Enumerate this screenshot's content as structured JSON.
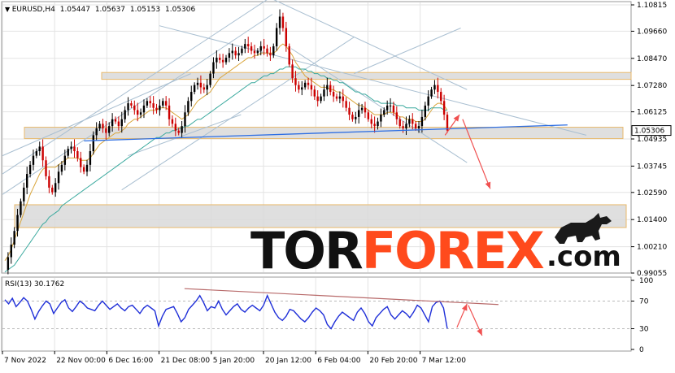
{
  "chart_data": [
    {
      "type": "candlestick",
      "symbol": "EURUSD",
      "timeframe": "H4",
      "ohlc": [
        "1.05447",
        "1.05637",
        "1.05153",
        "1.05306"
      ],
      "current_price": "1.05306",
      "y_tick_labels": [
        "1.10815",
        "1.09660",
        "1.08470",
        "1.07280",
        "1.06125",
        "1.04935",
        "1.03745",
        "1.02590",
        "1.01400",
        "1.00210",
        "0.99055"
      ],
      "y_ticks": [
        1.10815,
        1.0966,
        1.0847,
        1.0728,
        1.06125,
        1.04935,
        1.03745,
        1.0259,
        1.014,
        1.0021,
        0.99055
      ],
      "ylim": [
        0.99055,
        1.10815
      ],
      "x_tick_labels": [
        "7 Nov 2022",
        "22 Nov 00:00",
        "6 Dec 16:00",
        "21 Dec 08:00",
        "5 Jan 20:00",
        "20 Jan 12:00",
        "6 Feb 04:00",
        "20 Feb 20:00",
        "7 Mar 12:00"
      ],
      "grid": true,
      "close_series": [
        0.992,
        0.9975,
        1.003,
        1.009,
        1.016,
        1.022,
        1.028,
        1.034,
        1.038,
        1.042,
        1.044,
        1.046,
        1.04,
        1.033,
        1.028,
        1.026,
        1.03,
        1.035,
        1.038,
        1.042,
        1.045,
        1.046,
        1.044,
        1.041,
        1.037,
        1.035,
        1.038,
        1.044,
        1.051,
        1.054,
        1.056,
        1.054,
        1.052,
        1.055,
        1.058,
        1.057,
        1.055,
        1.058,
        1.062,
        1.065,
        1.064,
        1.062,
        1.06,
        1.061,
        1.064,
        1.066,
        1.065,
        1.063,
        1.062,
        1.064,
        1.066,
        1.064,
        1.058,
        1.056,
        1.053,
        1.052,
        1.055,
        1.061,
        1.066,
        1.07,
        1.073,
        1.074,
        1.072,
        1.071,
        1.073,
        1.078,
        1.083,
        1.085,
        1.084,
        1.083,
        1.085,
        1.087,
        1.088,
        1.086,
        1.087,
        1.089,
        1.091,
        1.09,
        1.088,
        1.087,
        1.088,
        1.09,
        1.089,
        1.087,
        1.086,
        1.09,
        1.098,
        1.103,
        1.098,
        1.09,
        1.082,
        1.076,
        1.073,
        1.071,
        1.072,
        1.074,
        1.073,
        1.071,
        1.068,
        1.066,
        1.068,
        1.071,
        1.073,
        1.07,
        1.068,
        1.067,
        1.068,
        1.066,
        1.063,
        1.06,
        1.058,
        1.059,
        1.062,
        1.063,
        1.061,
        1.058,
        1.056,
        1.055,
        1.057,
        1.06,
        1.062,
        1.064,
        1.064,
        1.061,
        1.058,
        1.055,
        1.054,
        1.056,
        1.058,
        1.056,
        1.054,
        1.055,
        1.059,
        1.064,
        1.068,
        1.071,
        1.073,
        1.07,
        1.066,
        1.06,
        1.05306
      ],
      "ma_series": [
        {
          "values": [
            0.996,
            0.998,
            1.001,
            1.005,
            1.009,
            1.013,
            1.017,
            1.021,
            1.025,
            1.028,
            1.031,
            1.034,
            1.036,
            1.037,
            1.037,
            1.037,
            1.037,
            1.038,
            1.039,
            1.04,
            1.041,
            1.041,
            1.041,
            1.041,
            1.04,
            1.04,
            1.04,
            1.041,
            1.043,
            1.045,
            1.047,
            1.048,
            1.049,
            1.05,
            1.051,
            1.052,
            1.052,
            1.053,
            1.054,
            1.056,
            1.057,
            1.058,
            1.058,
            1.059,
            1.06,
            1.061,
            1.062,
            1.062,
            1.062,
            1.063,
            1.063,
            1.063,
            1.062,
            1.061,
            1.06,
            1.059,
            1.058,
            1.059,
            1.06,
            1.062,
            1.064,
            1.066,
            1.067,
            1.068,
            1.069,
            1.07,
            1.072,
            1.074,
            1.076,
            1.077,
            1.078,
            1.079,
            1.08,
            1.081,
            1.082,
            1.083,
            1.084,
            1.085,
            1.085,
            1.086,
            1.086,
            1.087,
            1.087,
            1.087,
            1.087,
            1.087,
            1.088,
            1.09,
            1.091,
            1.09,
            1.088,
            1.086,
            1.083,
            1.081,
            1.079,
            1.077,
            1.076,
            1.075,
            1.074,
            1.073,
            1.072,
            1.072,
            1.072,
            1.071,
            1.071,
            1.07,
            1.07,
            1.069,
            1.068,
            1.067,
            1.066,
            1.065,
            1.064,
            1.064,
            1.063,
            1.062,
            1.061,
            1.06,
            1.06,
            1.06,
            1.06,
            1.061,
            1.061,
            1.061,
            1.06,
            1.059,
            1.059,
            1.058,
            1.058,
            1.058,
            1.057,
            1.057,
            1.057,
            1.058,
            1.06,
            1.062,
            1.064,
            1.065,
            1.065,
            1.064,
            1.062
          ]
        },
        {
          "values": [
            0.991,
            0.992,
            0.993,
            0.994,
            0.996,
            0.998,
            1.0,
            1.002,
            1.004,
            1.006,
            1.008,
            1.01,
            1.012,
            1.013,
            1.015,
            1.016,
            1.017,
            1.018,
            1.02,
            1.021,
            1.022,
            1.023,
            1.024,
            1.025,
            1.026,
            1.027,
            1.028,
            1.029,
            1.03,
            1.031,
            1.032,
            1.033,
            1.034,
            1.035,
            1.036,
            1.037,
            1.038,
            1.039,
            1.04,
            1.041,
            1.042,
            1.043,
            1.044,
            1.045,
            1.046,
            1.047,
            1.048,
            1.049,
            1.05,
            1.05,
            1.051,
            1.052,
            1.052,
            1.053,
            1.053,
            1.054,
            1.054,
            1.055,
            1.055,
            1.056,
            1.057,
            1.058,
            1.058,
            1.059,
            1.06,
            1.061,
            1.062,
            1.063,
            1.064,
            1.065,
            1.066,
            1.067,
            1.068,
            1.069,
            1.07,
            1.071,
            1.072,
            1.073,
            1.074,
            1.074,
            1.075,
            1.076,
            1.077,
            1.077,
            1.078,
            1.078,
            1.079,
            1.08,
            1.08,
            1.081,
            1.081,
            1.081,
            1.081,
            1.08,
            1.08,
            1.08,
            1.079,
            1.079,
            1.078,
            1.078,
            1.077,
            1.077,
            1.076,
            1.076,
            1.075,
            1.075,
            1.074,
            1.074,
            1.073,
            1.072,
            1.071,
            1.07,
            1.07,
            1.069,
            1.069,
            1.068,
            1.067,
            1.066,
            1.066,
            1.065,
            1.065,
            1.065,
            1.065,
            1.065,
            1.064,
            1.064,
            1.064,
            1.063,
            1.063,
            1.063,
            1.063,
            1.062,
            1.062,
            1.062,
            1.062,
            1.063,
            1.063,
            1.063,
            1.063,
            1.062,
            1.062
          ]
        }
      ],
      "zones": [
        {
          "from": 1.0755,
          "to": 1.0785
        },
        {
          "from": 1.0495,
          "to": 1.0545
        },
        {
          "from": 1.0105,
          "to": 1.0205
        }
      ],
      "trendline": {
        "from": [
          0.13,
          1.0485
        ],
        "to": [
          0.9,
          1.0555
        ]
      },
      "channel_lines": [
        {
          "from": [
            0.0,
            1.034
          ],
          "to": [
            0.43,
            1.112
          ]
        },
        {
          "from": [
            0.0,
            1.025
          ],
          "to": [
            0.43,
            1.104
          ]
        },
        {
          "from": [
            0.25,
            1.099
          ],
          "to": [
            0.93,
            1.051
          ]
        },
        {
          "from": [
            0.42,
            1.112
          ],
          "to": [
            0.74,
            1.071
          ]
        },
        {
          "from": [
            0.46,
            1.089
          ],
          "to": [
            0.74,
            1.039
          ]
        },
        {
          "from": [
            0.56,
            1.078
          ],
          "to": [
            0.73,
            1.098
          ]
        },
        {
          "from": [
            0.19,
            1.027
          ],
          "to": [
            0.56,
            1.094
          ]
        },
        {
          "from": [
            0.0,
            1.042
          ],
          "to": [
            0.3,
            1.078
          ]
        },
        {
          "from": [
            0.2,
            1.042
          ],
          "to": [
            0.38,
            1.06
          ]
        }
      ],
      "forecast_arrows": [
        {
          "from": [
            0.705,
            1.051
          ],
          "to": [
            0.728,
            1.06
          ]
        },
        {
          "from": [
            0.733,
            1.058
          ],
          "to": [
            0.777,
            1.0275
          ]
        }
      ]
    },
    {
      "type": "line",
      "title": "RSI(13) 30.1762",
      "y_tick_labels": [
        "100",
        "70",
        "30",
        "0"
      ],
      "y_ticks": [
        100,
        70,
        30,
        0
      ],
      "ylim": [
        0,
        100
      ],
      "levels": [
        70,
        30
      ],
      "values": [
        72,
        66,
        74,
        62,
        68,
        75,
        70,
        58,
        44,
        55,
        63,
        70,
        66,
        52,
        60,
        68,
        72,
        60,
        55,
        62,
        70,
        66,
        60,
        58,
        56,
        64,
        70,
        64,
        58,
        62,
        66,
        60,
        56,
        62,
        64,
        58,
        52,
        60,
        64,
        60,
        56,
        34,
        48,
        58,
        60,
        62,
        52,
        40,
        46,
        58,
        64,
        70,
        78,
        68,
        56,
        62,
        60,
        70,
        58,
        50,
        56,
        62,
        66,
        58,
        54,
        60,
        64,
        60,
        56,
        64,
        78,
        66,
        54,
        46,
        42,
        48,
        58,
        56,
        50,
        44,
        40,
        46,
        54,
        60,
        56,
        50,
        36,
        30,
        40,
        48,
        54,
        50,
        46,
        42,
        54,
        60,
        52,
        40,
        34,
        46,
        52,
        58,
        62,
        50,
        44,
        50,
        56,
        52,
        46,
        54,
        64,
        60,
        50,
        40,
        62,
        68,
        70,
        60,
        30.1762
      ],
      "divergence_line": {
        "from": [
          0.29,
          88
        ],
        "to": [
          0.79,
          65
        ]
      },
      "forecast_arrows": [
        {
          "from": [
            0.724,
            32
          ],
          "to": [
            0.74,
            66
          ]
        },
        {
          "from": [
            0.742,
            64
          ],
          "to": [
            0.764,
            20
          ]
        }
      ]
    }
  ],
  "watermark": {
    "tor": "TOR",
    "forex": "FOREX",
    "com": ".com",
    "colors": {
      "tor": "#111111",
      "forex": "#ff4a1c",
      "com": "#111111"
    }
  },
  "colors": {
    "bull": "#000000",
    "bear": "#cc0000",
    "ma_fast": "#d9a53a",
    "ma_slow": "#3aa99e",
    "trend": "#2d6ee3",
    "channel": "#a9bfd1",
    "zone_fill": "#d9d9d9",
    "zone_border": "#e8b96b",
    "arrow": "#f05050",
    "rsi": "#1f2fd8",
    "divergence": "#b86a6a"
  }
}
